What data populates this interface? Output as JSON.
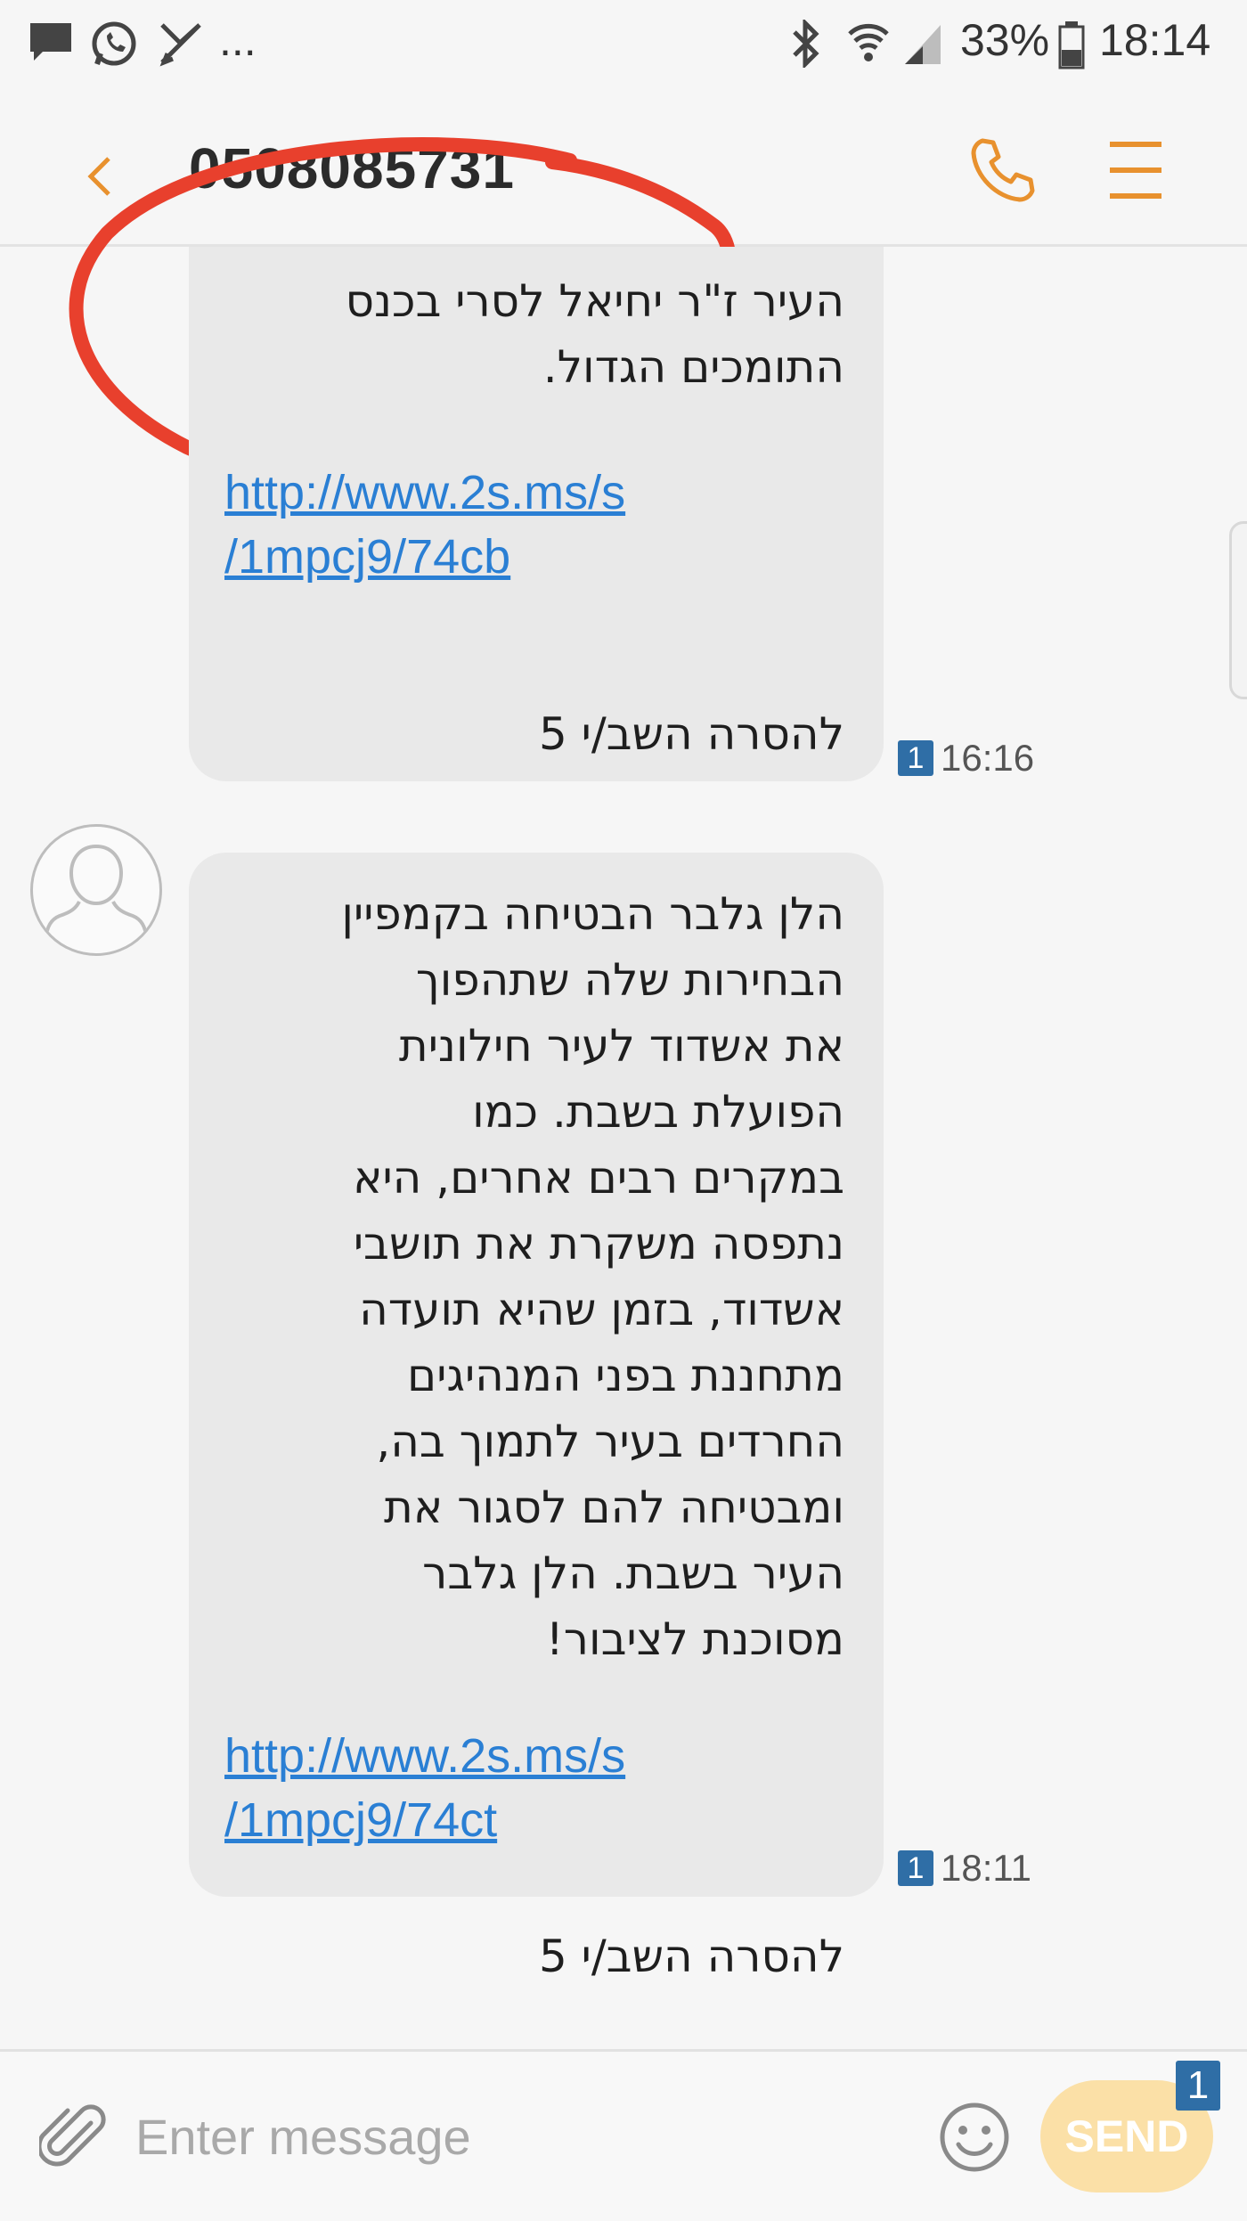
{
  "status_bar": {
    "battery": "33%",
    "time": "18:14",
    "overflow": "...",
    "left_icons": [
      "message-icon",
      "whatsapp-icon",
      "missed-call-icon"
    ],
    "right_icons": [
      "bluetooth-icon",
      "wifi-icon",
      "signal-icon",
      "battery-icon"
    ]
  },
  "header": {
    "title": "0508085731",
    "back_icon": "back-arrow-icon",
    "call_icon": "phone-icon",
    "menu_icon": "menu-icon",
    "accent_color": "#e8912e",
    "annotation_color": "#e8402d"
  },
  "messages": [
    {
      "text": "העיר ז\"ר יחיאל לסרי בכנס\nהתומכים הגדול.",
      "link": "http://www.2s.ms/s\n/1mpcj9/74cb",
      "footer": "להסרה השב/י 5",
      "badge": "1",
      "time": "16:16"
    },
    {
      "text": "הלן גלבר הבטיחה בקמפיין\nהבחירות שלה שתהפוך\nאת אשדוד לעיר חילונית\nהפועלת בשבת. כמו\nבמקרים רבים אחרים, היא\nנתפסה משקרת את תושבי\nאשדוד, בזמן שהיא תועדה\nמתחננת בפני המנהיגים\nהחרדים בעיר לתמוך בה,\nומבטיחה להם לסגור את\nהעיר בשבת. הלן גלבר\nמסוכנת לציבור!",
      "link": "http://www.2s.ms/s\n/1mpcj9/74ct",
      "footer": "להסרה השב/י 5",
      "badge": "1",
      "time": "18:11"
    }
  ],
  "composer": {
    "placeholder": "Enter message",
    "send_label": "SEND",
    "send_badge": "1",
    "send_color": "#fbe0a7",
    "attach_icon": "paperclip-icon",
    "emoji_icon": "emoji-icon"
  }
}
